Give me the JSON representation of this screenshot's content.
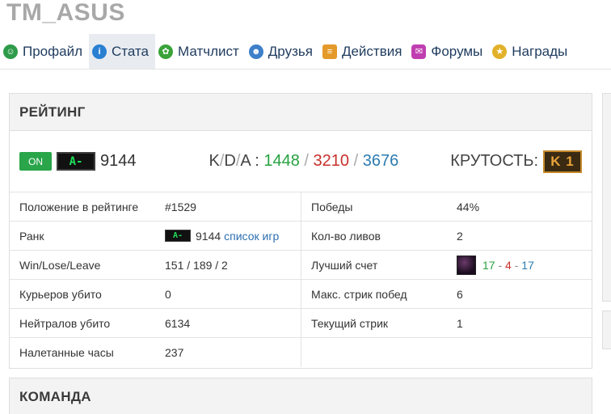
{
  "user": {
    "name": "TM_ASUS"
  },
  "tabs": [
    {
      "label": "Профайл",
      "icon": "profile-icon",
      "color": "#2e9b4a"
    },
    {
      "label": "Стата",
      "icon": "stats-icon",
      "color": "#2a7fd1"
    },
    {
      "label": "Матчлист",
      "icon": "matchlist-icon",
      "color": "#3aa33a"
    },
    {
      "label": "Друзья",
      "icon": "friends-icon",
      "color": "#3e7fc9"
    },
    {
      "label": "Действия",
      "icon": "actions-icon",
      "color": "#e49a2a"
    },
    {
      "label": "Форумы",
      "icon": "forums-icon",
      "color": "#c03fb0"
    },
    {
      "label": "Награды",
      "icon": "awards-icon",
      "color": "#e2b12a"
    }
  ],
  "rating": {
    "title": "РЕЙТИНГ",
    "status": "ON",
    "rank": "A-",
    "value": "9144",
    "kda_label": "K/D/A :",
    "kda_k_letter": "K",
    "kda_d_letter": "D",
    "kda_a_letter": "A",
    "kills": "1448",
    "deaths": "3210",
    "assists": "3676",
    "coolness_label": "КРУТОСТЬ:",
    "coolness_badge": "K 1"
  },
  "stats_left": [
    {
      "label": "Положение в рейтинге",
      "value": "#1529"
    },
    {
      "label": "Ранк",
      "rank": "A-",
      "value": "9144",
      "link": "список игр"
    },
    {
      "label": "Win/Lose/Leave",
      "value": "151 / 189 / 2"
    },
    {
      "label": "Курьеров убито",
      "value": "0"
    },
    {
      "label": "Нейтралов убито",
      "value": "6134"
    },
    {
      "label": "Налетанные часы",
      "value": "237"
    }
  ],
  "stats_right": [
    {
      "label": "Победы",
      "value": "44%"
    },
    {
      "label": "Кол-во ливов",
      "value": "2"
    },
    {
      "label": "Лучший счет",
      "k": "17",
      "d": "4",
      "a": "17"
    },
    {
      "label": "Макс. стрик побед",
      "value": "6"
    },
    {
      "label": "Текущий стрик",
      "value": "1"
    }
  ],
  "team": {
    "title": "КОМАНДА"
  }
}
